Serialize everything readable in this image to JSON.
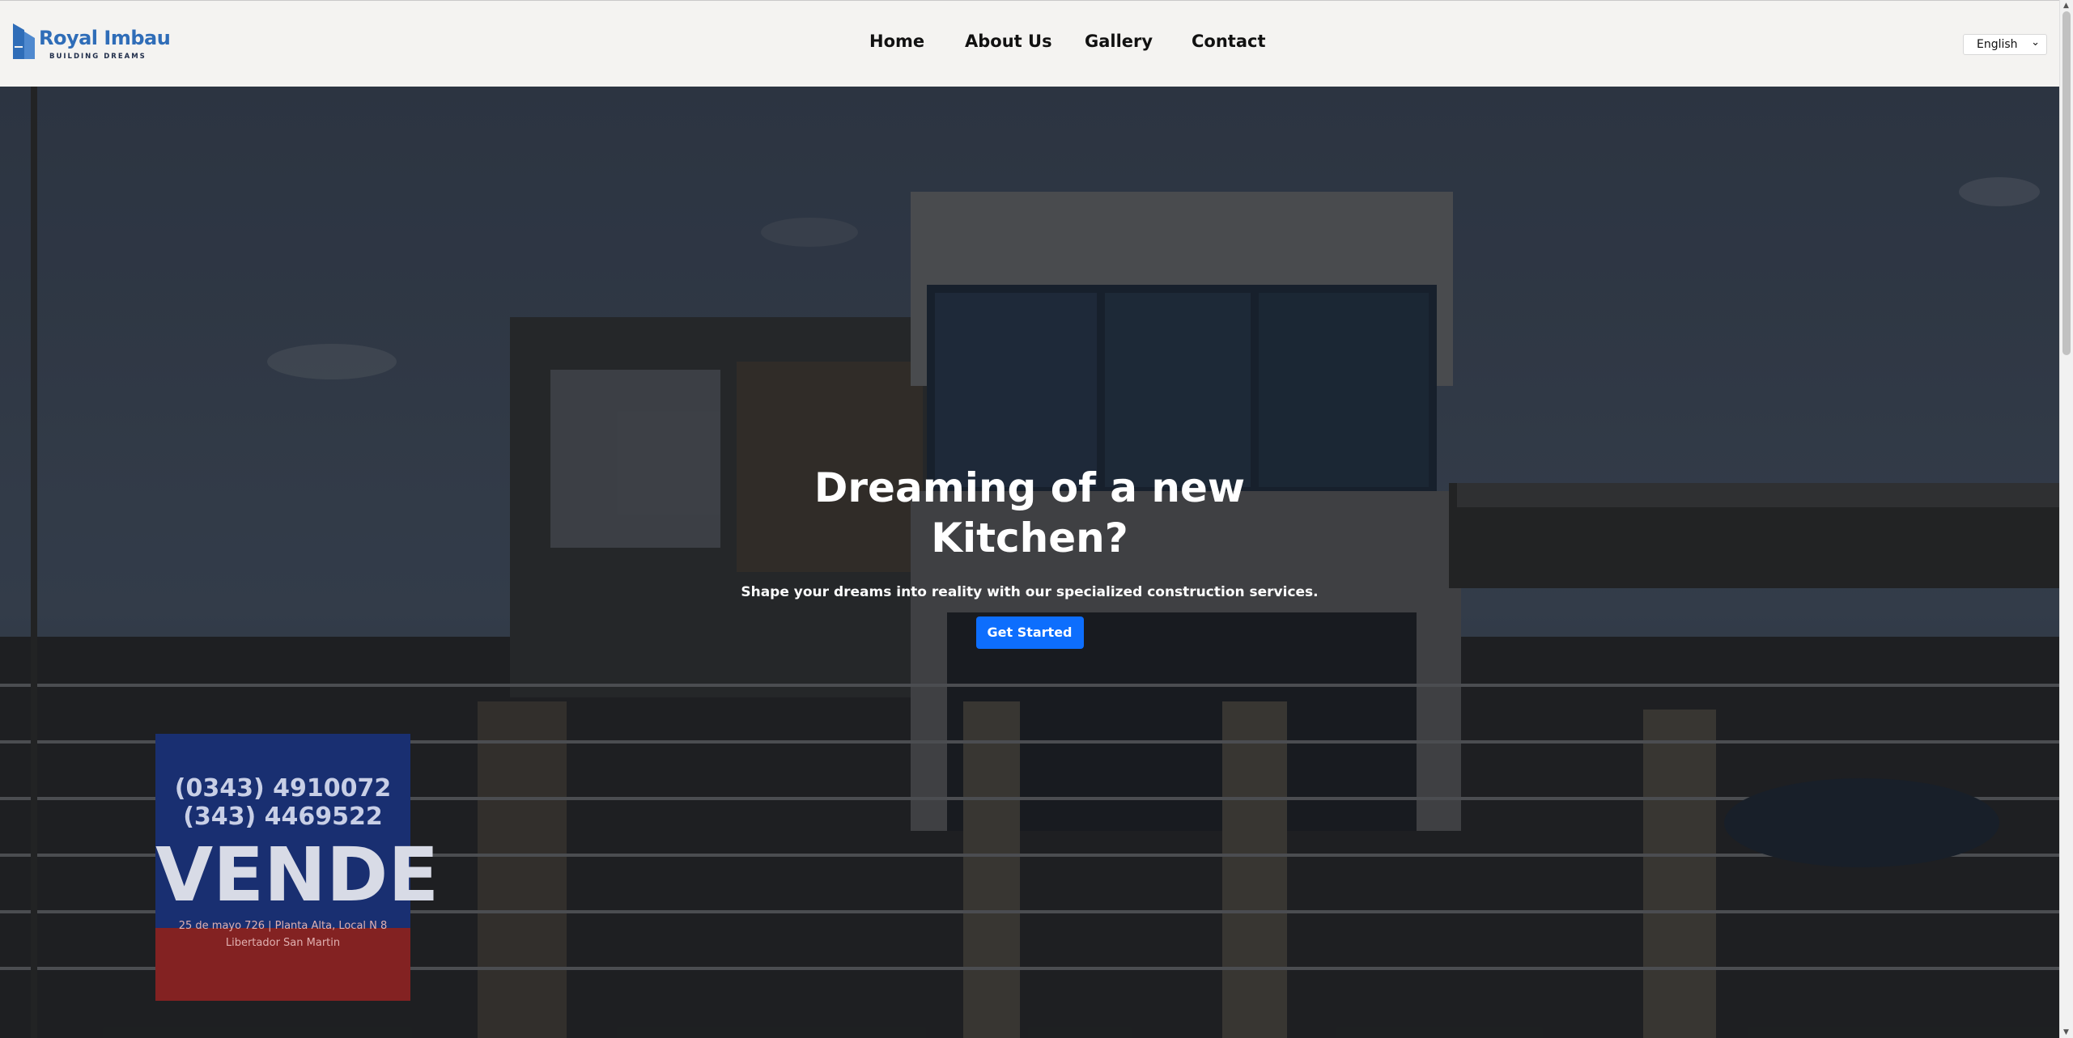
{
  "brand": {
    "name": "Royal Imbau",
    "tagline": "BUILDING DREAMS",
    "color": "#2f6db8"
  },
  "nav": {
    "items": [
      {
        "label": "Home"
      },
      {
        "label": "About Us"
      },
      {
        "label": "Gallery"
      },
      {
        "label": "Contact"
      }
    ]
  },
  "language": {
    "selected": "English",
    "icon": "chevron-down-icon"
  },
  "hero": {
    "title": "Dreaming of a new Kitchen?",
    "subtitle": "Shape your dreams into reality with our specialized construction services.",
    "cta_label": "Get Started",
    "cta_color": "#0d6efd"
  },
  "background_sign": {
    "phone_1": "(0343) 4910072",
    "phone_2": "(343) 4469522",
    "word": "VENDE",
    "address": "25 de mayo 726 | Planta Alta, Local N 8",
    "city": "Libertador San Martin"
  }
}
